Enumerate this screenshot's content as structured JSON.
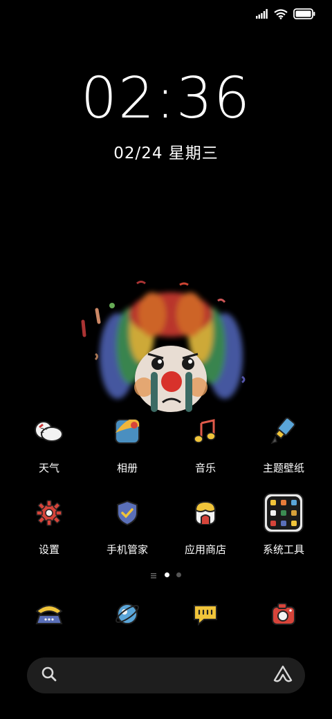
{
  "status_bar": {
    "signal_icon": "signal-icon",
    "wifi_icon": "wifi-icon",
    "battery_icon": "battery-icon"
  },
  "lock": {
    "time": "02:36",
    "date": "02/24 星期三"
  },
  "apps_row1": [
    {
      "label": "天气",
      "icon": "weather-icon"
    },
    {
      "label": "相册",
      "icon": "gallery-icon"
    },
    {
      "label": "音乐",
      "icon": "music-icon"
    },
    {
      "label": "主题壁纸",
      "icon": "theme-brush-icon"
    }
  ],
  "apps_row2": [
    {
      "label": "设置",
      "icon": "settings-gear-icon"
    },
    {
      "label": "手机管家",
      "icon": "security-shield-icon"
    },
    {
      "label": "应用商店",
      "icon": "app-store-icon"
    },
    {
      "label": "系统工具",
      "icon": "folder-icon"
    }
  ],
  "dock": [
    {
      "icon": "phone-icon"
    },
    {
      "icon": "browser-planet-icon"
    },
    {
      "icon": "messages-icon"
    },
    {
      "icon": "camera-icon"
    }
  ],
  "page_indicator": {
    "pages": 2,
    "active": 1
  },
  "search": {
    "placeholder": ""
  },
  "colors": {
    "background": "#000000",
    "search_bg": "#1e1e1e"
  }
}
